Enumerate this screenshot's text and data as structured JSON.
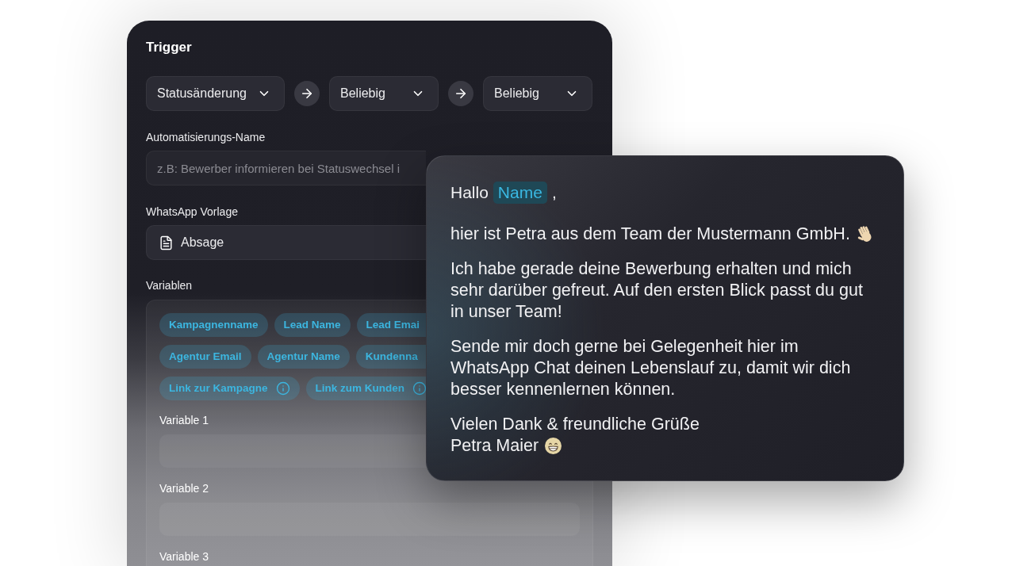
{
  "trigger": {
    "title": "Trigger",
    "dropdowns": [
      {
        "value": "Statusänderung"
      },
      {
        "value": "Beliebig"
      },
      {
        "value": "Beliebig"
      }
    ]
  },
  "automation_name": {
    "label": "Automatisierungs-Name",
    "placeholder": "z.B: Bewerber informieren bei Statuswechsel i"
  },
  "whatsapp_template": {
    "label": "WhatsApp Vorlage",
    "value": "Absage"
  },
  "variables": {
    "label": "Variablen",
    "tag_rows": [
      [
        {
          "label": "Kampagnenname",
          "info": false
        },
        {
          "label": "Lead Name",
          "info": false
        },
        {
          "label": "Lead Emai",
          "info": false
        }
      ],
      [
        {
          "label": "Agentur Email",
          "info": false
        },
        {
          "label": "Agentur Name",
          "info": false
        },
        {
          "label": "Kundenna",
          "info": false
        }
      ],
      [
        {
          "label": "Link zur Kampagne",
          "info": true
        },
        {
          "label": "Link zum Kunden",
          "info": true
        }
      ]
    ],
    "fields": [
      {
        "label": "Variable 1",
        "input": true
      },
      {
        "label": "Variable 2",
        "input": true
      },
      {
        "label": "Variable 3",
        "input": false
      }
    ]
  },
  "message": {
    "greeting": {
      "text": "Hallo",
      "variable": "Name",
      "punctuation": ","
    },
    "paragraphs": [
      {
        "lines": [
          {
            "kind": "wave",
            "text": "hier ist Petra aus dem Team der Mustermann GmbH."
          }
        ]
      },
      {
        "lines": [
          {
            "kind": "plain",
            "text": "Ich habe gerade deine Bewerbung erhalten und mich sehr darüber gefreut. Auf den ersten Blick passt du gut in unser Team!"
          }
        ]
      },
      {
        "lines": [
          {
            "kind": "plain",
            "text": "Sende mir doch gerne bei Gelegenheit hier im WhatsApp Chat deinen Lebenslauf zu, damit wir dich besser kennenlernen können."
          }
        ]
      },
      {
        "lines": [
          {
            "kind": "plain",
            "text": "Vielen Dank & freundliche Grüße"
          },
          {
            "kind": "grin",
            "text": "Petra Maier"
          }
        ]
      }
    ]
  }
}
